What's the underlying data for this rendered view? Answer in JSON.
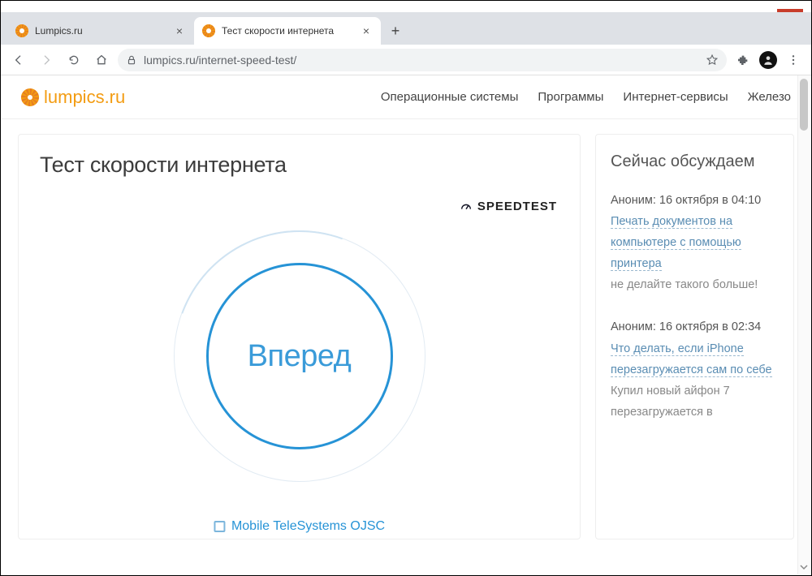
{
  "tabs": [
    {
      "title": "Lumpics.ru"
    },
    {
      "title": "Тест скорости интернета"
    }
  ],
  "url": "lumpics.ru/internet-speed-test/",
  "site": {
    "logo_text": "lumpics.ru",
    "nav": [
      "Операционные системы",
      "Программы",
      "Интернет-сервисы",
      "Железо"
    ]
  },
  "main": {
    "title": "Тест скорости интернета",
    "brand": "SPEEDTEST",
    "go_label": "Вперед",
    "isp": "Mobile TeleSystems OJSC"
  },
  "sidebar": {
    "title": "Сейчас обсуждаем",
    "items": [
      {
        "meta": "Аноним: 16 октября в 04:10",
        "link": "Печать документов на компьютере с помощью принтера",
        "comment": "не делайте такого больше!"
      },
      {
        "meta": "Аноним: 16 октября в 02:34",
        "link": "Что делать, если iPhone перезагружается сам по себе",
        "comment": "Купил новый айфон 7 перезагружается в"
      }
    ]
  }
}
